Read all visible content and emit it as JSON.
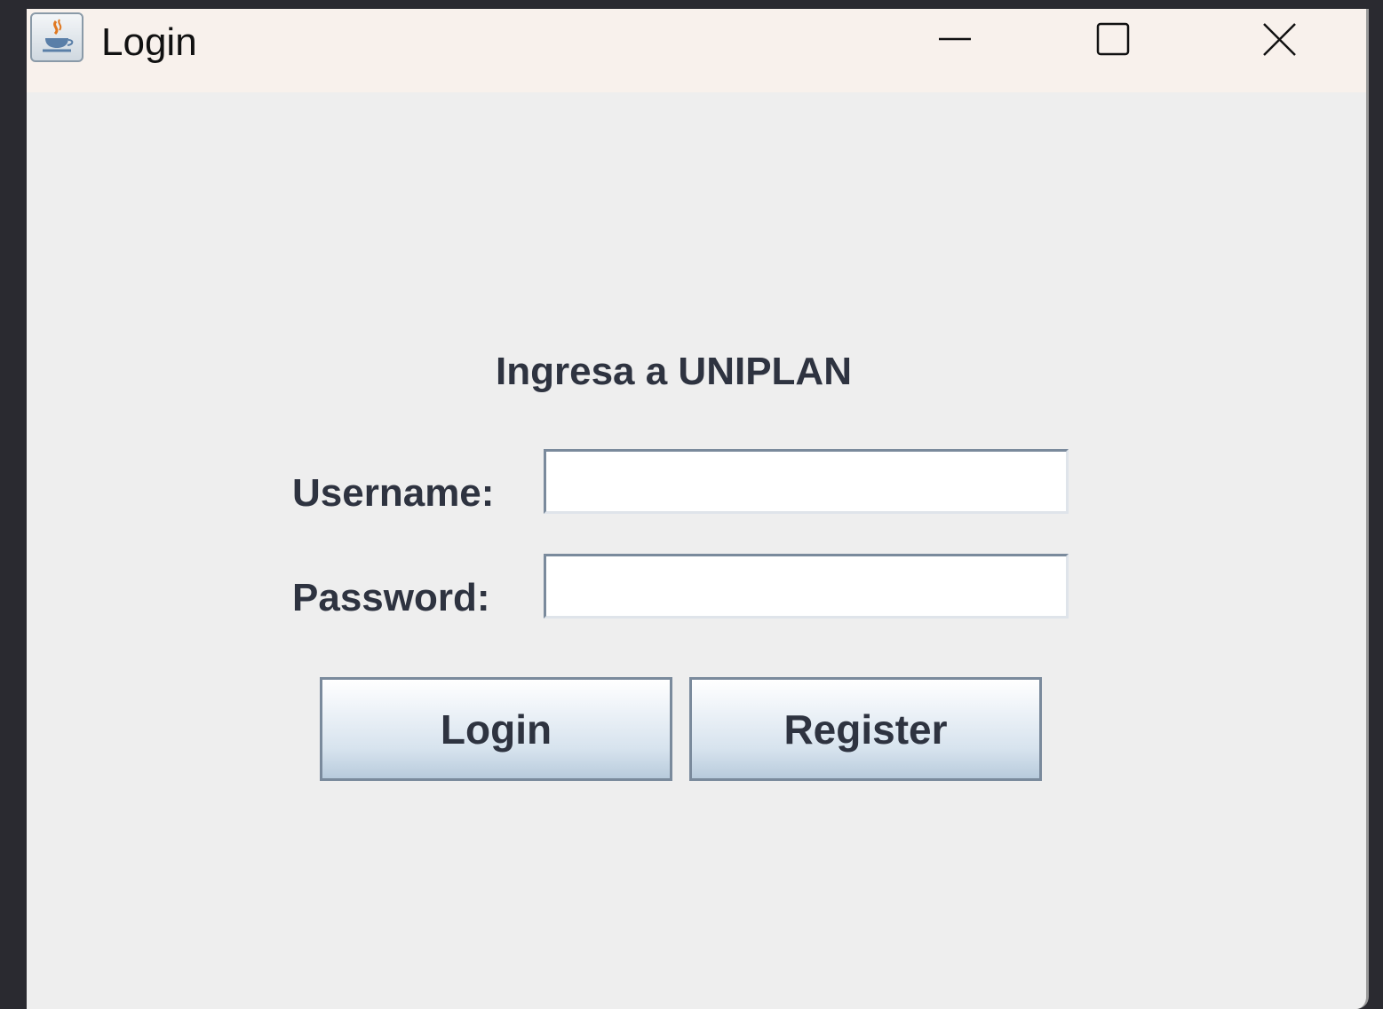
{
  "window": {
    "title": "Login",
    "app_icon": "java-icon",
    "controls": [
      "minimize-icon",
      "maximize-icon",
      "close-icon"
    ]
  },
  "form": {
    "heading": "Ingresa a UNIPLAN",
    "username_label": "Username:",
    "username_value": "",
    "password_label": "Password:",
    "password_value": "",
    "login_button": "Login",
    "register_button": "Register"
  },
  "colors": {
    "titlebar": "#f8f1ec",
    "content_bg": "#eeeeee",
    "text": "#2e3340",
    "border": "#7a8a9c",
    "desktop": "#2a2a30"
  }
}
